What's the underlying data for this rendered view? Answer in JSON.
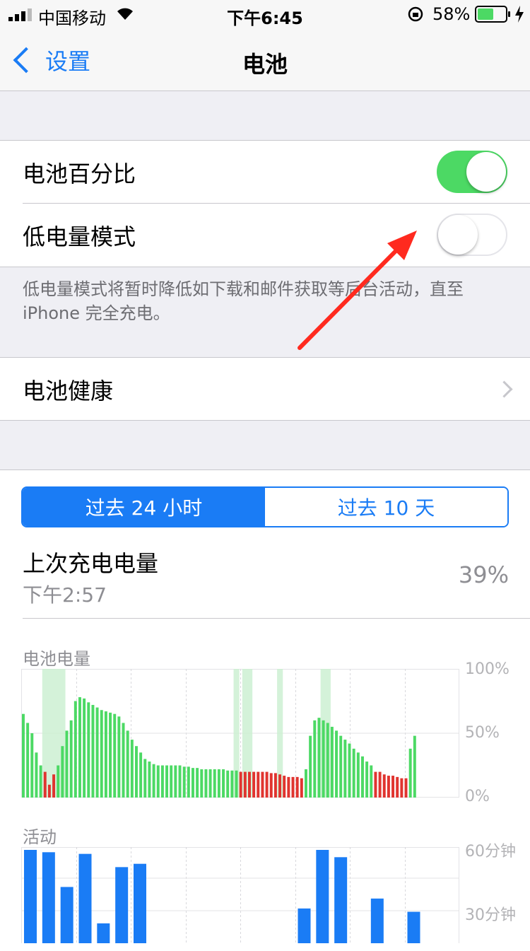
{
  "status": {
    "carrier": "中国移动",
    "time": "下午6:45",
    "battery_percent": "58%",
    "battery_level": 0.58
  },
  "nav": {
    "back_label": "设置",
    "title": "电池"
  },
  "settings": {
    "battery_percentage_label": "电池百分比",
    "battery_percentage_on": true,
    "low_power_label": "低电量模式",
    "low_power_on": false,
    "low_power_note": "低电量模式将暂时降低如下载和邮件获取等后台活动，直至 iPhone 完全充电。",
    "battery_health_label": "电池健康"
  },
  "usage": {
    "tabs": [
      "过去 24 小时",
      "过去 10 天"
    ],
    "active_tab": 0,
    "last_charge_label": "上次充电电量",
    "last_charge_time": "下午2:57",
    "last_charge_value": "39%",
    "battery_chart_label": "电池电量",
    "activity_chart_label": "活动"
  },
  "colors": {
    "accent": "#1a7cf5",
    "green": "#4cd964",
    "red": "#e0342f",
    "charging_band": "#c9efcf"
  },
  "chart_data": [
    {
      "type": "bar",
      "title": "电池电量",
      "yticks": [
        "100%",
        "50%",
        "0%"
      ],
      "ylim": [
        0,
        100
      ],
      "charging_periods": [
        [
          5,
          9
        ],
        [
          49,
          49
        ],
        [
          51,
          52
        ],
        [
          59,
          59
        ],
        [
          69,
          70
        ]
      ],
      "values": [
        65,
        58,
        50,
        35,
        25,
        20,
        10,
        18,
        25,
        40,
        52,
        60,
        75,
        78,
        77,
        74,
        72,
        70,
        68,
        67,
        66,
        65,
        63,
        58,
        52,
        45,
        40,
        35,
        30,
        28,
        26,
        25,
        25,
        25,
        25,
        25,
        25,
        24,
        24,
        23,
        23,
        22,
        22,
        22,
        22,
        22,
        22,
        21,
        21,
        21,
        20,
        20,
        20,
        20,
        20,
        20,
        20,
        19,
        19,
        18,
        17,
        16,
        16,
        16,
        15,
        22,
        48,
        60,
        62,
        60,
        58,
        55,
        52,
        48,
        45,
        42,
        38,
        35,
        32,
        28,
        25,
        20,
        20,
        18,
        17,
        17,
        16,
        15,
        15,
        38,
        48
      ],
      "low_threshold": 20
    },
    {
      "type": "bar",
      "title": "活动",
      "yticks": [
        "60分钟",
        "30分钟"
      ],
      "ylim": [
        0,
        60
      ],
      "bars": [
        {
          "slot": 0,
          "value": 58
        },
        {
          "slot": 1,
          "value": 55
        },
        {
          "slot": 2,
          "value": 34
        },
        {
          "slot": 3,
          "value": 54
        },
        {
          "slot": 4,
          "value": 12
        },
        {
          "slot": 5,
          "value": 46
        },
        {
          "slot": 6,
          "value": 48
        },
        {
          "slot": 15,
          "value": 21
        },
        {
          "slot": 16,
          "value": 59
        },
        {
          "slot": 17,
          "value": 52
        },
        {
          "slot": 19,
          "value": 27
        },
        {
          "slot": 21,
          "value": 19
        }
      ]
    }
  ]
}
